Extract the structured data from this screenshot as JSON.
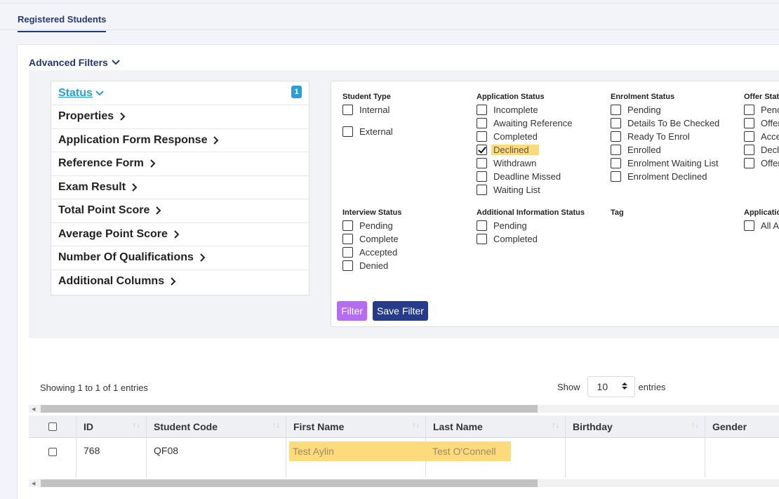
{
  "tab": {
    "label": "Registered Students"
  },
  "advanced_filters": {
    "label": "Advanced Filters"
  },
  "left_menu": [
    {
      "label": "Status",
      "badge": "1"
    },
    {
      "label": "Properties"
    },
    {
      "label": "Application Form Response"
    },
    {
      "label": "Reference Form"
    },
    {
      "label": "Exam Result"
    },
    {
      "label": "Total Point Score"
    },
    {
      "label": "Average Point Score"
    },
    {
      "label": "Number Of Qualifications"
    },
    {
      "label": "Additional Columns"
    }
  ],
  "groups": {
    "student_type": {
      "title": "Student Type",
      "options": [
        "Internal",
        "External"
      ]
    },
    "application_status": {
      "title": "Application Status",
      "options": [
        "Incomplete",
        "Awaiting Reference",
        "Completed",
        "Declined",
        "Withdrawn",
        "Deadline Missed",
        "Waiting List"
      ],
      "checked": "Declined"
    },
    "enrolment_status": {
      "title": "Enrolment Status",
      "options": [
        "Pending",
        "Details To Be Checked",
        "Ready To Enrol",
        "Enrolled",
        "Enrolment Waiting List",
        "Enrolment Declined"
      ]
    },
    "offer_status": {
      "title": "Offer Stat",
      "options": [
        "Penc",
        "Offer",
        "Acce",
        "Decl",
        "Offer"
      ]
    },
    "interview_status": {
      "title": "Interview Status",
      "options": [
        "Pending",
        "Complete",
        "Accepted",
        "Denied"
      ]
    },
    "additional_info_status": {
      "title": "Additional Information Status",
      "options": [
        "Pending",
        "Completed"
      ]
    },
    "tag": {
      "title": "Tag"
    },
    "application_col": {
      "title": "Applicatio",
      "options": [
        "All A"
      ]
    }
  },
  "buttons": {
    "filter": "Filter",
    "save_filter": "Save Filter"
  },
  "table_info": {
    "showing": "Showing 1 to 1 of 1 entries",
    "show": "Show",
    "entries_value": "10",
    "entries": "entries"
  },
  "table": {
    "columns": [
      "ID",
      "Student Code",
      "First Name",
      "Last Name",
      "Birthday",
      "Gender"
    ],
    "rows": [
      {
        "id": "768",
        "student_code": "QF08",
        "first_name": "Test Aylin",
        "last_name": "Test O'Connell",
        "birthday": "",
        "gender": ""
      }
    ]
  },
  "colors": {
    "primary": "#233876",
    "accent": "#2a9fd6",
    "highlight": "#fdda7b",
    "filter_button": "#b46df0",
    "save_button": "#263b8a"
  }
}
